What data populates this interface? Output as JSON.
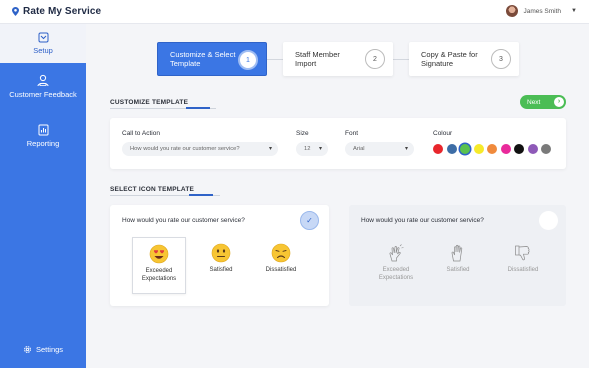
{
  "app": {
    "title": "Rate My Service"
  },
  "user": {
    "name": "James Smith"
  },
  "sidebar": {
    "items": [
      {
        "label": "Setup",
        "icon": "setup-icon",
        "active": true
      },
      {
        "label": "Customer Feedback",
        "icon": "customer-feedback-icon"
      },
      {
        "label": "Reporting",
        "icon": "reporting-icon"
      },
      {
        "label": "Settings",
        "icon": "gear-icon"
      }
    ]
  },
  "steps": [
    {
      "label": "Customize & Select Template",
      "number": "1",
      "active": true
    },
    {
      "label": "Staff Member Import",
      "number": "2"
    },
    {
      "label": "Copy & Paste for Signature",
      "number": "3"
    }
  ],
  "customize": {
    "heading": "CUSTOMIZE TEMPLATE",
    "next_label": "Next",
    "call_to_action": {
      "label": "Call to Action",
      "value": "How would you rate our customer service?"
    },
    "size": {
      "label": "Size",
      "value": "12"
    },
    "font": {
      "label": "Font",
      "value": "Arial"
    },
    "colour": {
      "label": "Colour",
      "swatches": [
        "#e8262c",
        "#3d6da6",
        "#5ac24f",
        "#f6ea2a",
        "#f08a3c",
        "#e92a9b",
        "#111111",
        "#8e5ab8",
        "#7a7a7a"
      ],
      "selected": "#5ac24f"
    }
  },
  "icon_template": {
    "heading": "SELECT ICON TEMPLATE",
    "templates": [
      {
        "question": "How would you rate our customer service?",
        "selected": true,
        "options": [
          {
            "label": "Exceeded Expectations",
            "icon": "heart-eyes-emoji-icon"
          },
          {
            "label": "Satisfied",
            "icon": "neutral-face-emoji-icon"
          },
          {
            "label": "Dissatisfied",
            "icon": "sad-face-emoji-icon"
          }
        ]
      },
      {
        "question": "How would you rate our customer service?",
        "selected": false,
        "options": [
          {
            "label": "Exceeded Expectations",
            "icon": "clapping-hands-icon"
          },
          {
            "label": "Satisfied",
            "icon": "raised-hand-icon"
          },
          {
            "label": "Dissatisfied",
            "icon": "thumbs-down-icon"
          }
        ]
      }
    ]
  },
  "colors": {
    "accent": "#3b76e4",
    "next": "#4bbd55",
    "sidebar": "#3b76e4"
  }
}
